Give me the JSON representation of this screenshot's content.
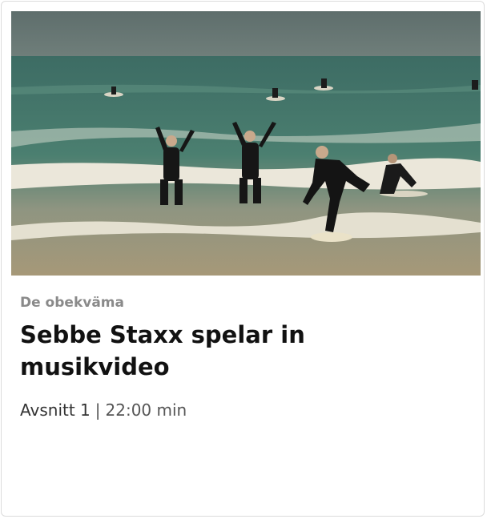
{
  "card": {
    "series_name": "De obekväma",
    "title": "Sebbe Staxx spelar in musikvideo",
    "episode": "Avsnitt 1",
    "separator": "|",
    "duration": "22:00 min"
  },
  "colors": {
    "series_gray": "#8a8a8a",
    "title_black": "#111111",
    "sky": "#617270",
    "sea_green": "#3b6a62",
    "foam": "#e6e2d4",
    "sand_water": "#9b9276"
  }
}
